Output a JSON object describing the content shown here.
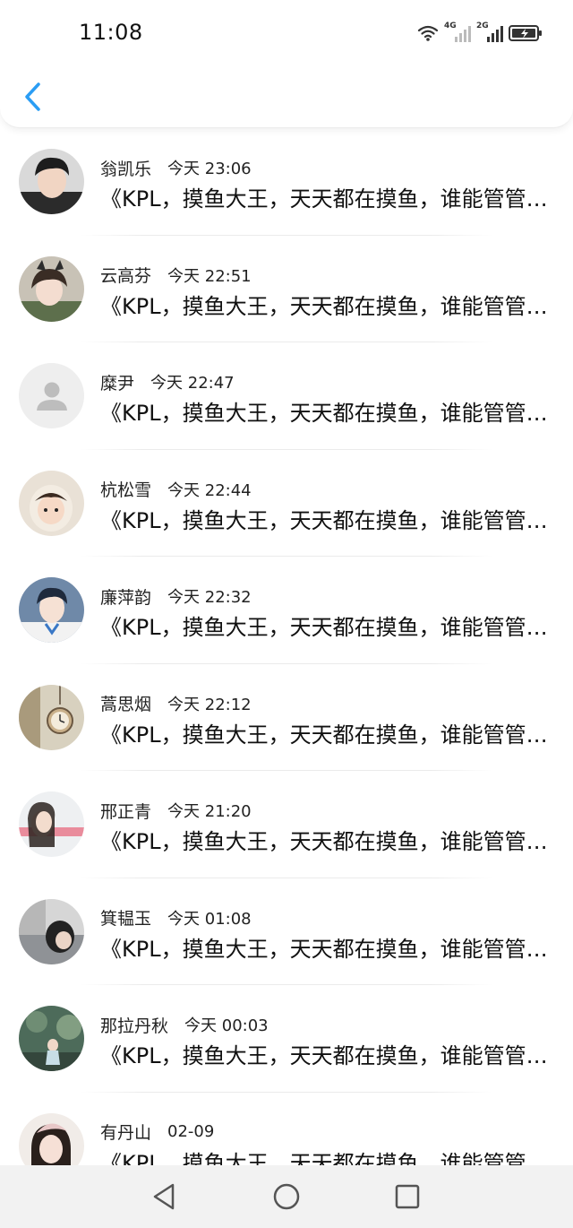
{
  "status_bar": {
    "time": "11:08",
    "network_1": "4G",
    "network_2": "2G"
  },
  "header": {
    "back_icon": "chevron-left-icon",
    "accent_color": "#2a9df4"
  },
  "messages": [
    {
      "name": "翁凯乐",
      "time": "今天 23:06",
      "text": "《KPL，摸鱼大王，天天都在摸鱼，谁能管管他》",
      "avatar": "photo"
    },
    {
      "name": "云高芬",
      "time": "今天 22:51",
      "text": "《KPL，摸鱼大王，天天都在摸鱼，谁能管管他》",
      "avatar": "photo"
    },
    {
      "name": "糜尹",
      "time": "今天 22:47",
      "text": "《KPL，摸鱼大王，天天都在摸鱼，谁能管管他》",
      "avatar": "default-user-icon"
    },
    {
      "name": "杭松雪",
      "time": "今天 22:44",
      "text": "《KPL，摸鱼大王，天天都在摸鱼，谁能管管他》",
      "avatar": "photo"
    },
    {
      "name": "廉萍韵",
      "time": "今天 22:32",
      "text": "《KPL，摸鱼大王，天天都在摸鱼，谁能管管他》",
      "avatar": "photo"
    },
    {
      "name": "蒿思烟",
      "time": "今天 22:12",
      "text": "《KPL，摸鱼大王，天天都在摸鱼，谁能管管他》",
      "avatar": "photo"
    },
    {
      "name": "邢正青",
      "time": "今天 21:20",
      "text": "《KPL，摸鱼大王，天天都在摸鱼，谁能管管他》",
      "avatar": "photo"
    },
    {
      "name": "箕韫玉",
      "time": "今天 01:08",
      "text": "《KPL，摸鱼大王，天天都在摸鱼，谁能管管他》",
      "avatar": "photo"
    },
    {
      "name": "那拉丹秋",
      "time": "今天 00:03",
      "text": "《KPL，摸鱼大王，天天都在摸鱼，谁能管管他》",
      "avatar": "photo"
    },
    {
      "name": "有丹山",
      "time": "02-09",
      "text": "《KPL，摸鱼大王，天天都在摸鱼，谁能管管他》",
      "avatar": "photo"
    }
  ],
  "nav": {
    "back": "triangle-back-icon",
    "home": "circle-home-icon",
    "recents": "square-recents-icon"
  }
}
